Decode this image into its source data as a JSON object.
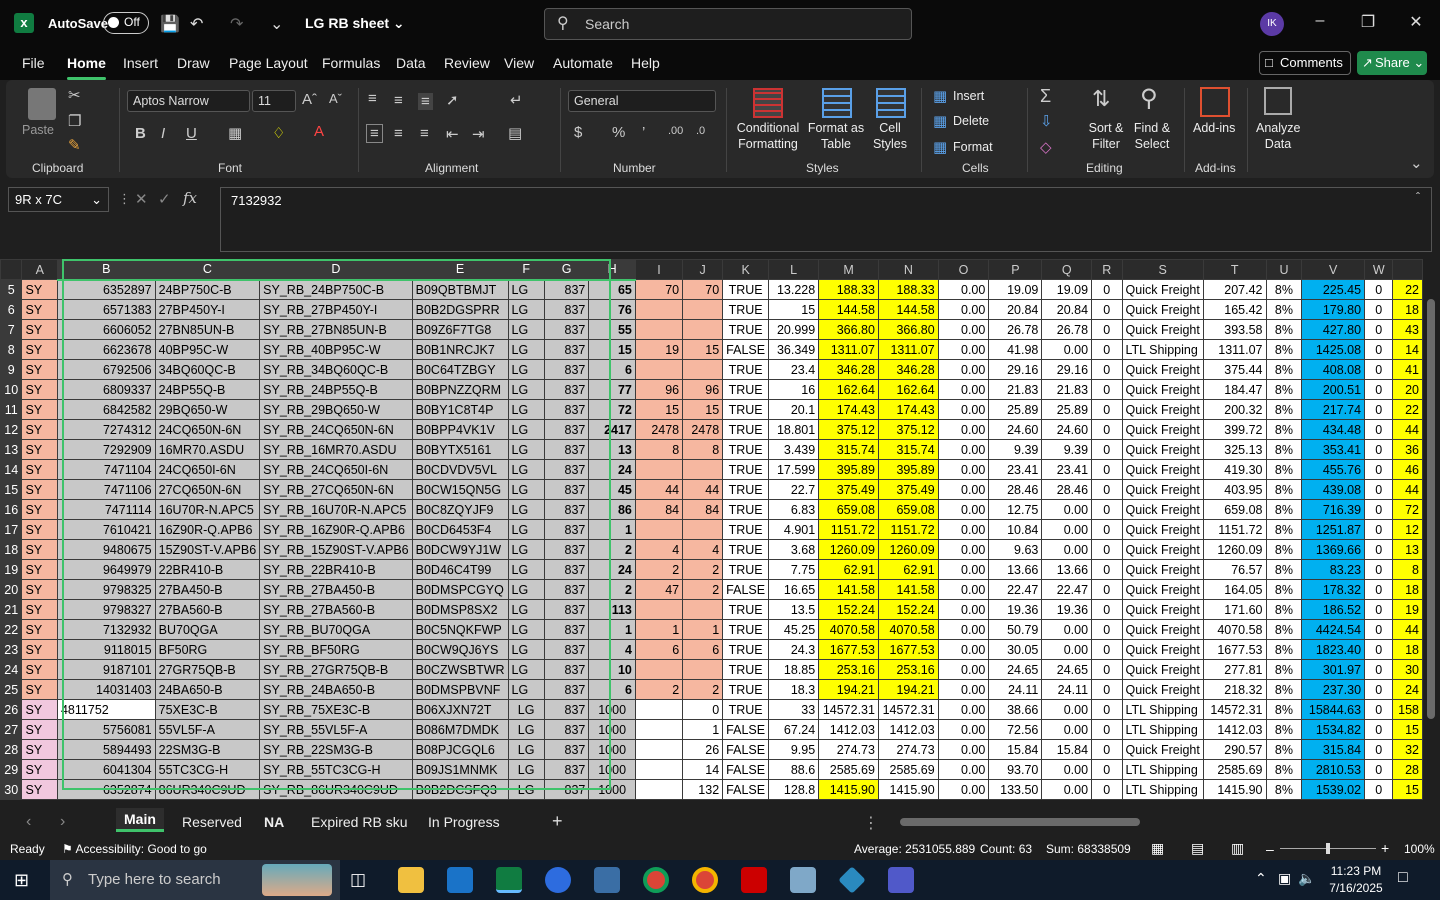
{
  "titlebar": {
    "autosave": "AutoSave",
    "toggle": "Off",
    "doc_title": "LG RB sheet",
    "search_placeholder": "Search",
    "avatar": "IK"
  },
  "menu": [
    "File",
    "Home",
    "Insert",
    "Draw",
    "Page Layout",
    "Formulas",
    "Data",
    "Review",
    "View",
    "Automate",
    "Help"
  ],
  "buttons": {
    "comments": "Comments",
    "share": "Share"
  },
  "ribbon": {
    "paste": "Paste",
    "clipboard": "Clipboard",
    "font_name": "Aptos Narrow",
    "font_size": "11",
    "font": "Font",
    "alignment": "Alignment",
    "number_format": "General",
    "number": "Number",
    "conditional": "Conditional Formatting",
    "format_table": "Format as Table",
    "cell_styles": "Cell Styles",
    "styles": "Styles",
    "insert": "Insert",
    "delete": "Delete",
    "format": "Format",
    "cells": "Cells",
    "sort": "Sort & Filter",
    "find": "Find & Select",
    "editing": "Editing",
    "addins": "Add-ins",
    "addins_group": "Add-ins",
    "analyze": "Analyze Data"
  },
  "formula_bar": {
    "name_box": "9R x 7C",
    "formula": "7132932"
  },
  "columns": [
    "A",
    "B",
    "C",
    "D",
    "E",
    "F",
    "G",
    "H",
    "I",
    "J",
    "K",
    "L",
    "M",
    "N",
    "O",
    "P",
    "Q",
    "R",
    "S",
    "T",
    "U",
    "V",
    "W"
  ],
  "rows": [
    {
      "n": "5",
      "a": "SY",
      "b": "6352897",
      "c": "24BP750C-B",
      "d": "SY_RB_24BP750C-B",
      "e": "B09QBTBMJT",
      "f": "LG",
      "g": "837",
      "h": "65",
      "i": "70",
      "j": "70",
      "k": "TRUE",
      "l": "13.228",
      "m": "188.33",
      "n2": "188.33",
      "o": "0.00",
      "p": "19.09",
      "q": "19.09",
      "r": "0",
      "s": "Quick Freight",
      "t": "207.42",
      "u": "8%",
      "v": "225.45",
      "w": "0",
      "x": "22"
    },
    {
      "n": "6",
      "a": "SY",
      "b": "6571383",
      "c": "27BP450Y-I",
      "d": "SY_RB_27BP450Y-I",
      "e": "B0B2DGSPRR",
      "f": "LG",
      "g": "837",
      "h": "76",
      "i": "",
      "j": "",
      "k": "TRUE",
      "l": "15",
      "m": "144.58",
      "n2": "144.58",
      "o": "0.00",
      "p": "20.84",
      "q": "20.84",
      "r": "0",
      "s": "Quick Freight",
      "t": "165.42",
      "u": "8%",
      "v": "179.80",
      "w": "0",
      "x": "18"
    },
    {
      "n": "7",
      "a": "SY",
      "b": "6606052",
      "c": "27BN85UN-B",
      "d": "SY_RB_27BN85UN-B",
      "e": "B09Z6F7TG8",
      "f": "LG",
      "g": "837",
      "h": "55",
      "i": "",
      "j": "",
      "k": "TRUE",
      "l": "20.999",
      "m": "366.80",
      "n2": "366.80",
      "o": "0.00",
      "p": "26.78",
      "q": "26.78",
      "r": "0",
      "s": "Quick Freight",
      "t": "393.58",
      "u": "8%",
      "v": "427.80",
      "w": "0",
      "x": "43"
    },
    {
      "n": "8",
      "a": "SY",
      "b": "6623678",
      "c": "40BP95C-W",
      "d": "SY_RB_40BP95C-W",
      "e": "B0B1NRCJK7",
      "f": "LG",
      "g": "837",
      "h": "15",
      "i": "19",
      "j": "15",
      "k": "FALSE",
      "l": "36.349",
      "m": "1311.07",
      "n2": "1311.07",
      "o": "0.00",
      "p": "41.98",
      "q": "0.00",
      "r": "0",
      "s": "LTL Shipping",
      "t": "1311.07",
      "u": "8%",
      "v": "1425.08",
      "w": "0",
      "x": "14"
    },
    {
      "n": "9",
      "a": "SY",
      "b": "6792506",
      "c": "34BQ60QC-B",
      "d": "SY_RB_34BQ60QC-B",
      "e": "B0C64TZBGY",
      "f": "LG",
      "g": "837",
      "h": "6",
      "i": "",
      "j": "",
      "k": "TRUE",
      "l": "23.4",
      "m": "346.28",
      "n2": "346.28",
      "o": "0.00",
      "p": "29.16",
      "q": "29.16",
      "r": "0",
      "s": "Quick Freight",
      "t": "375.44",
      "u": "8%",
      "v": "408.08",
      "w": "0",
      "x": "41"
    },
    {
      "n": "10",
      "a": "SY",
      "b": "6809337",
      "c": "24BP55Q-B",
      "d": "SY_RB_24BP55Q-B",
      "e": "B0BPNZZQRM",
      "f": "LG",
      "g": "837",
      "h": "77",
      "i": "96",
      "j": "96",
      "k": "TRUE",
      "l": "16",
      "m": "162.64",
      "n2": "162.64",
      "o": "0.00",
      "p": "21.83",
      "q": "21.83",
      "r": "0",
      "s": "Quick Freight",
      "t": "184.47",
      "u": "8%",
      "v": "200.51",
      "w": "0",
      "x": "20"
    },
    {
      "n": "11",
      "a": "SY",
      "b": "6842582",
      "c": "29BQ650-W",
      "d": "SY_RB_29BQ650-W",
      "e": "B0BY1C8T4P",
      "f": "LG",
      "g": "837",
      "h": "72",
      "i": "15",
      "j": "15",
      "k": "TRUE",
      "l": "20.1",
      "m": "174.43",
      "n2": "174.43",
      "o": "0.00",
      "p": "25.89",
      "q": "25.89",
      "r": "0",
      "s": "Quick Freight",
      "t": "200.32",
      "u": "8%",
      "v": "217.74",
      "w": "0",
      "x": "22"
    },
    {
      "n": "12",
      "a": "SY",
      "b": "7274312",
      "c": "24CQ650N-6N",
      "d": "SY_RB_24CQ650N-6N",
      "e": "B0BPP4VK1V",
      "f": "LG",
      "g": "837",
      "h": "2417",
      "i": "2478",
      "j": "2478",
      "k": "TRUE",
      "l": "18.801",
      "m": "375.12",
      "n2": "375.12",
      "o": "0.00",
      "p": "24.60",
      "q": "24.60",
      "r": "0",
      "s": "Quick Freight",
      "t": "399.72",
      "u": "8%",
      "v": "434.48",
      "w": "0",
      "x": "44"
    },
    {
      "n": "13",
      "a": "SY",
      "b": "7292909",
      "c": "16MR70.ASDU",
      "d": "SY_RB_16MR70.ASDU",
      "e": "B0BYTX5161",
      "f": "LG",
      "g": "837",
      "h": "13",
      "i": "8",
      "j": "8",
      "k": "TRUE",
      "l": "3.439",
      "m": "315.74",
      "n2": "315.74",
      "o": "0.00",
      "p": "9.39",
      "q": "9.39",
      "r": "0",
      "s": "Quick Freight",
      "t": "325.13",
      "u": "8%",
      "v": "353.41",
      "w": "0",
      "x": "36"
    },
    {
      "n": "14",
      "a": "SY",
      "b": "7471104",
      "c": "24CQ650I-6N",
      "d": "SY_RB_24CQ650I-6N",
      "e": "B0CDVDV5VL",
      "f": "LG",
      "g": "837",
      "h": "24",
      "i": "",
      "j": "",
      "k": "TRUE",
      "l": "17.599",
      "m": "395.89",
      "n2": "395.89",
      "o": "0.00",
      "p": "23.41",
      "q": "23.41",
      "r": "0",
      "s": "Quick Freight",
      "t": "419.30",
      "u": "8%",
      "v": "455.76",
      "w": "0",
      "x": "46"
    },
    {
      "n": "15",
      "a": "SY",
      "b": "7471106",
      "c": "27CQ650N-6N",
      "d": "SY_RB_27CQ650N-6N",
      "e": "B0CW15QN5G",
      "f": "LG",
      "g": "837",
      "h": "45",
      "i": "44",
      "j": "44",
      "k": "TRUE",
      "l": "22.7",
      "m": "375.49",
      "n2": "375.49",
      "o": "0.00",
      "p": "28.46",
      "q": "28.46",
      "r": "0",
      "s": "Quick Freight",
      "t": "403.95",
      "u": "8%",
      "v": "439.08",
      "w": "0",
      "x": "44"
    },
    {
      "n": "16",
      "a": "SY",
      "b": "7471114",
      "c": "16U70R-N.APC5",
      "d": "SY_RB_16U70R-N.APC5",
      "e": "B0C8ZQYJF9",
      "f": "LG",
      "g": "837",
      "h": "86",
      "i": "84",
      "j": "84",
      "k": "TRUE",
      "l": "6.83",
      "m": "659.08",
      "n2": "659.08",
      "o": "0.00",
      "p": "12.75",
      "q": "0.00",
      "r": "0",
      "s": "Quick Freight",
      "t": "659.08",
      "u": "8%",
      "v": "716.39",
      "w": "0",
      "x": "72"
    },
    {
      "n": "17",
      "a": "SY",
      "b": "7610421",
      "c": "16Z90R-Q.APB6",
      "d": "SY_RB_16Z90R-Q.APB6",
      "e": "B0CD6453F4",
      "f": "LG",
      "g": "837",
      "h": "1",
      "i": "",
      "j": "",
      "k": "TRUE",
      "l": "4.901",
      "m": "1151.72",
      "n2": "1151.72",
      "o": "0.00",
      "p": "10.84",
      "q": "0.00",
      "r": "0",
      "s": "Quick Freight",
      "t": "1151.72",
      "u": "8%",
      "v": "1251.87",
      "w": "0",
      "x": "12"
    },
    {
      "n": "18",
      "a": "SY",
      "b": "9480675",
      "c": "15Z90ST-V.APB6",
      "d": "SY_RB_15Z90ST-V.APB6",
      "e": "B0DCW9YJ1W",
      "f": "LG",
      "g": "837",
      "h": "2",
      "i": "4",
      "j": "4",
      "k": "TRUE",
      "l": "3.68",
      "m": "1260.09",
      "n2": "1260.09",
      "o": "0.00",
      "p": "9.63",
      "q": "0.00",
      "r": "0",
      "s": "Quick Freight",
      "t": "1260.09",
      "u": "8%",
      "v": "1369.66",
      "w": "0",
      "x": "13"
    },
    {
      "n": "19",
      "a": "SY",
      "b": "9649979",
      "c": "22BR410-B",
      "d": "SY_RB_22BR410-B",
      "e": "B0D46C4T99",
      "f": "LG",
      "g": "837",
      "h": "24",
      "i": "2",
      "j": "2",
      "k": "TRUE",
      "l": "7.75",
      "m": "62.91",
      "n2": "62.91",
      "o": "0.00",
      "p": "13.66",
      "q": "13.66",
      "r": "0",
      "s": "Quick Freight",
      "t": "76.57",
      "u": "8%",
      "v": "83.23",
      "w": "0",
      "x": "8"
    },
    {
      "n": "20",
      "a": "SY",
      "b": "9798325",
      "c": "27BA450-B",
      "d": "SY_RB_27BA450-B",
      "e": "B0DMSPCGYQ",
      "f": "LG",
      "g": "837",
      "h": "2",
      "i": "47",
      "j": "2",
      "k": "FALSE",
      "l": "16.65",
      "m": "141.58",
      "n2": "141.58",
      "o": "0.00",
      "p": "22.47",
      "q": "22.47",
      "r": "0",
      "s": "Quick Freight",
      "t": "164.05",
      "u": "8%",
      "v": "178.32",
      "w": "0",
      "x": "18"
    },
    {
      "n": "21",
      "a": "SY",
      "b": "9798327",
      "c": "27BA560-B",
      "d": "SY_RB_27BA560-B",
      "e": "B0DMSP8SX2",
      "f": "LG",
      "g": "837",
      "h": "113",
      "i": "",
      "j": "",
      "k": "TRUE",
      "l": "13.5",
      "m": "152.24",
      "n2": "152.24",
      "o": "0.00",
      "p": "19.36",
      "q": "19.36",
      "r": "0",
      "s": "Quick Freight",
      "t": "171.60",
      "u": "8%",
      "v": "186.52",
      "w": "0",
      "x": "19"
    },
    {
      "n": "22",
      "a": "SY",
      "b": "7132932",
      "c": "BU70QGA",
      "d": "SY_RB_BU70QGA",
      "e": "B0C5NQKFWP",
      "f": "LG",
      "g": "837",
      "h": "1",
      "i": "1",
      "j": "1",
      "k": "TRUE",
      "l": "45.25",
      "m": "4070.58",
      "n2": "4070.58",
      "o": "0.00",
      "p": "50.79",
      "q": "0.00",
      "r": "0",
      "s": "Quick Freight",
      "t": "4070.58",
      "u": "8%",
      "v": "4424.54",
      "w": "0",
      "x": "44"
    },
    {
      "n": "23",
      "a": "SY",
      "b": "9118015",
      "c": "BF50RG",
      "d": "SY_RB_BF50RG",
      "e": "B0CW9QJ6YS",
      "f": "LG",
      "g": "837",
      "h": "4",
      "i": "6",
      "j": "6",
      "k": "TRUE",
      "l": "24.3",
      "m": "1677.53",
      "n2": "1677.53",
      "o": "0.00",
      "p": "30.05",
      "q": "0.00",
      "r": "0",
      "s": "Quick Freight",
      "t": "1677.53",
      "u": "8%",
      "v": "1823.40",
      "w": "0",
      "x": "18"
    },
    {
      "n": "24",
      "a": "SY",
      "b": "9187101",
      "c": "27GR75QB-B",
      "d": "SY_RB_27GR75QB-B",
      "e": "B0CZWSBTWR",
      "f": "LG",
      "g": "837",
      "h": "10",
      "i": "",
      "j": "",
      "k": "TRUE",
      "l": "18.85",
      "m": "253.16",
      "n2": "253.16",
      "o": "0.00",
      "p": "24.65",
      "q": "24.65",
      "r": "0",
      "s": "Quick Freight",
      "t": "277.81",
      "u": "8%",
      "v": "301.97",
      "w": "0",
      "x": "30"
    },
    {
      "n": "25",
      "a": "SY",
      "b": "14031403",
      "c": "24BA650-B",
      "d": "SY_RB_24BA650-B",
      "e": "B0DMSPBVNF",
      "f": "LG",
      "g": "837",
      "h": "6",
      "i": "2",
      "j": "2",
      "k": "TRUE",
      "l": "18.3",
      "m": "194.21",
      "n2": "194.21",
      "o": "0.00",
      "p": "24.11",
      "q": "24.11",
      "r": "0",
      "s": "Quick Freight",
      "t": "218.32",
      "u": "8%",
      "v": "237.30",
      "w": "0",
      "x": "24"
    },
    {
      "n": "26",
      "a": "SY",
      "b": "4811752",
      "c": "75XE3C-B",
      "d": "SY_RB_75XE3C-B",
      "e": "B06XJXN72T",
      "f": "LG",
      "g": "837",
      "h": "1000",
      "i": "",
      "j": "0",
      "k": "TRUE",
      "l": "33",
      "m": "14572.31",
      "n2": "14572.31",
      "o": "0.00",
      "p": "38.66",
      "q": "0.00",
      "r": "0",
      "s": "LTL Shipping",
      "t": "14572.31",
      "u": "8%",
      "v": "15844.63",
      "w": "0",
      "x": "158"
    },
    {
      "n": "27",
      "a": "SY",
      "b": "5756081",
      "c": "55VL5F-A",
      "d": "SY_RB_55VL5F-A",
      "e": "B086M7DMDK",
      "f": "LG",
      "g": "837",
      "h": "1000",
      "i": "",
      "j": "1",
      "k": "FALSE",
      "l": "67.24",
      "m": "1412.03",
      "n2": "1412.03",
      "o": "0.00",
      "p": "72.56",
      "q": "0.00",
      "r": "0",
      "s": "LTL Shipping",
      "t": "1412.03",
      "u": "8%",
      "v": "1534.82",
      "w": "0",
      "x": "15"
    },
    {
      "n": "28",
      "a": "SY",
      "b": "5894493",
      "c": "22SM3G-B",
      "d": "SY_RB_22SM3G-B",
      "e": "B08PJCGQL6",
      "f": "LG",
      "g": "837",
      "h": "1000",
      "i": "",
      "j": "26",
      "k": "FALSE",
      "l": "9.95",
      "m": "274.73",
      "n2": "274.73",
      "o": "0.00",
      "p": "15.84",
      "q": "15.84",
      "r": "0",
      "s": "Quick Freight",
      "t": "290.57",
      "u": "8%",
      "v": "315.84",
      "w": "0",
      "x": "32"
    },
    {
      "n": "29",
      "a": "SY",
      "b": "6041304",
      "c": "55TC3CG-H",
      "d": "SY_RB_55TC3CG-H",
      "e": "B09JS1MNMK",
      "f": "LG",
      "g": "837",
      "h": "1000",
      "i": "",
      "j": "14",
      "k": "FALSE",
      "l": "88.6",
      "m": "2585.69",
      "n2": "2585.69",
      "o": "0.00",
      "p": "93.70",
      "q": "0.00",
      "r": "0",
      "s": "LTL Shipping",
      "t": "2585.69",
      "u": "8%",
      "v": "2810.53",
      "w": "0",
      "x": "28"
    },
    {
      "n": "30",
      "a": "SY",
      "b": "6352874",
      "c": "86UR340C9UD",
      "d": "SY_RB_86UR340C9UD",
      "e": "B0B2DCSFQ3",
      "f": "LG",
      "g": "837",
      "h": "1000",
      "i": "",
      "j": "132",
      "k": "FALSE",
      "l": "128.8",
      "m": "1415.90",
      "n2": "1415.90",
      "o": "0.00",
      "p": "133.50",
      "q": "0.00",
      "r": "0",
      "s": "LTL Shipping",
      "t": "1415.90",
      "u": "8%",
      "v": "1539.02",
      "w": "0",
      "x": "15"
    }
  ],
  "sheets": [
    "Main",
    "Reserved",
    "NA",
    "Expired RB sku",
    "In Progress"
  ],
  "status": {
    "ready": "Ready",
    "accessibility": "Accessibility: Good to go",
    "average": "Average: 2531055.889",
    "count": "Count: 63",
    "sum": "Sum: 68338509",
    "zoom": "100%"
  },
  "taskbar": {
    "search_placeholder": "Type here to search",
    "time": "11:23 PM",
    "date": "7/16/2025"
  },
  "colors": {
    "excel_green": "#107c41",
    "accent": "#3fc36b",
    "highlight_yellow": "#ffff00",
    "highlight_blue": "#00b0f0",
    "salmon": "#f6b7a0",
    "pink": "#f1c8de"
  }
}
